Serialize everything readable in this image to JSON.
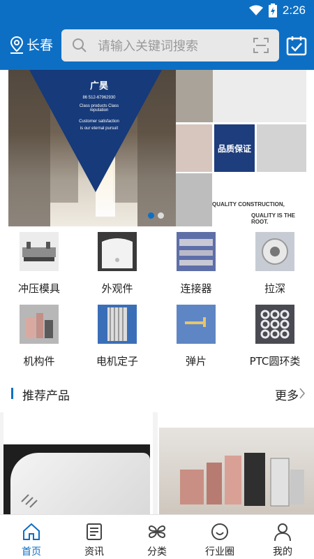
{
  "status_bar": {
    "time": "2:26"
  },
  "header": {
    "city": "长春",
    "search": {
      "placeholder": "请输入关键词搜索"
    }
  },
  "banner": {
    "company": "广昊",
    "phone": "86 512-67962930",
    "slogan_1": "Class products  Class reputation",
    "slogan_2": "Customer satisfaction",
    "slogan_3": "is our eternal pursuit",
    "quality_badge": "品质保证",
    "quality_line_1": "QUALITY CONSTRUCTION,",
    "quality_line_2": "QUALITY IS THE ROOT.",
    "slide_count": 2,
    "active_slide": 1
  },
  "categories": [
    {
      "label": "冲压模具",
      "thumb_color": "#d9d9d9"
    },
    {
      "label": "外观件",
      "thumb_color": "#3a3a3a"
    },
    {
      "label": "连接器",
      "thumb_color": "#5e6fa8"
    },
    {
      "label": "拉深",
      "thumb_color": "#c7ccd4"
    },
    {
      "label": "机构件",
      "thumb_color": "#b7b7b7"
    },
    {
      "label": "电机定子",
      "thumb_color": "#3a6fb8"
    },
    {
      "label": "弹片",
      "thumb_color": "#5f86c4"
    },
    {
      "label": "PTC圆环类",
      "thumb_color": "#4a4a52"
    }
  ],
  "recommended": {
    "title": "推荐产品",
    "more": "更多"
  },
  "tabs": [
    {
      "label": "首页",
      "icon": "home-icon",
      "active": true
    },
    {
      "label": "资讯",
      "icon": "news-icon",
      "active": false
    },
    {
      "label": "分类",
      "icon": "category-icon",
      "active": false
    },
    {
      "label": "行业圈",
      "icon": "circle-icon",
      "active": false
    },
    {
      "label": "我的",
      "icon": "user-icon",
      "active": false
    }
  ],
  "colors": {
    "primary": "#0d6fc4",
    "banner_navy": "#163a7a"
  }
}
